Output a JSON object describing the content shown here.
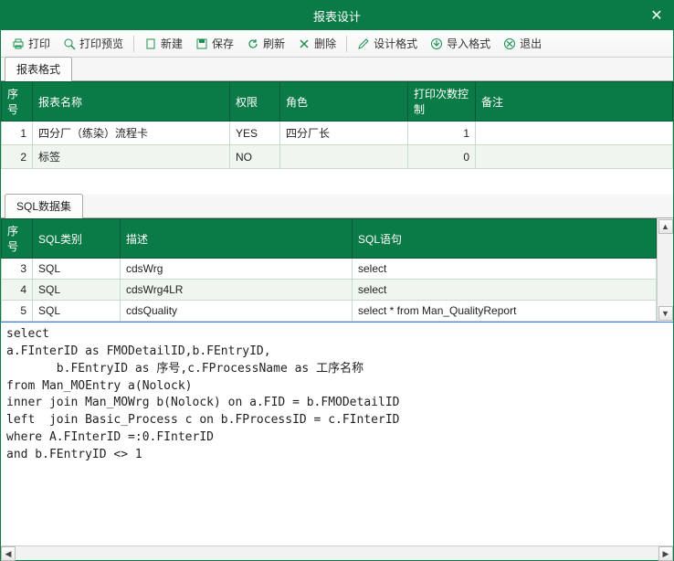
{
  "window": {
    "title": "报表设计"
  },
  "toolbar": {
    "print": "打印",
    "print_preview": "打印预览",
    "new": "新建",
    "save": "保存",
    "refresh": "刷新",
    "delete": "删除",
    "design_format": "设计格式",
    "import_format": "导入格式",
    "exit": "退出"
  },
  "tabs": {
    "format": "报表格式",
    "sql": "SQL数据集"
  },
  "grid1": {
    "headers": {
      "idx": "序号",
      "name": "报表名称",
      "perm": "权限",
      "role": "角色",
      "print_ctrl": "打印次数控制",
      "remark": "备注"
    },
    "rows": [
      {
        "idx": "1",
        "name": "四分厂（练染）流程卡",
        "perm": "YES",
        "role": "四分厂长",
        "print_ctrl": "1",
        "remark": ""
      },
      {
        "idx": "2",
        "name": "标签",
        "perm": "NO",
        "role": "",
        "print_ctrl": "0",
        "remark": ""
      }
    ]
  },
  "grid2": {
    "headers": {
      "idx": "序号",
      "sql_type": "SQL类别",
      "desc": "描述",
      "sql": "SQL语句"
    },
    "rows": [
      {
        "idx": "3",
        "sql_type": "SQL",
        "desc": "cdsWrg",
        "sql": "select"
      },
      {
        "idx": "4",
        "sql_type": "SQL",
        "desc": "cdsWrg4LR",
        "sql": "select"
      },
      {
        "idx": "5",
        "sql_type": "SQL",
        "desc": "cdsQuality",
        "sql": "select * from Man_QualityReport"
      }
    ]
  },
  "sql_text": "select\na.FInterID as FMODetailID,b.FEntryID,\n       b.FEntryID as 序号,c.FProcessName as 工序名称\nfrom Man_MOEntry a(Nolock)\ninner join Man_MOWrg b(Nolock) on a.FID = b.FMODetailID\nleft  join Basic_Process c on b.FProcessID = c.FInterID\nwhere A.FInterID =:0.FInterID\nand b.FEntryID <> 1"
}
